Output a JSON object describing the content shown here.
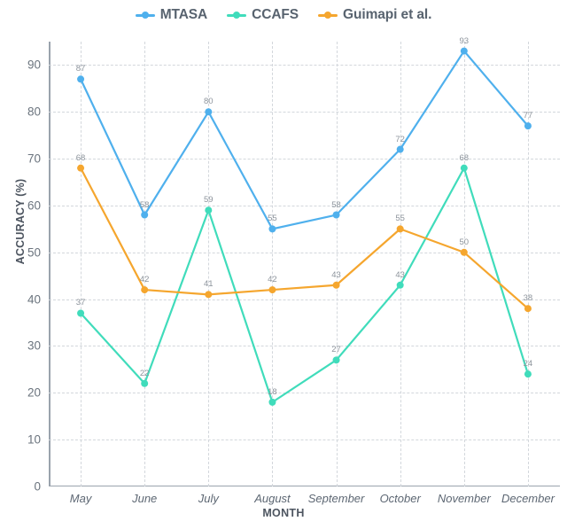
{
  "legend": {
    "position": "top-center",
    "items": [
      {
        "label": "MTASA",
        "color": "#4FB0ED",
        "marker": "line-dot-marker"
      },
      {
        "label": "CCAFS",
        "color": "#40DCBB",
        "marker": "line-dot-marker"
      },
      {
        "label": "Guimapi et al.",
        "color": "#F5A62E",
        "marker": "line-dot-marker"
      }
    ]
  },
  "axes": {
    "y_title": "ACCURACY (%)",
    "x_title": "MONTH",
    "y_ticks": [
      "0",
      "10",
      "20",
      "30",
      "40",
      "50",
      "60",
      "70",
      "80",
      "90"
    ]
  },
  "chart_data": {
    "type": "line",
    "title": "",
    "subtitle": "",
    "xlabel": "MONTH",
    "ylabel": "ACCURACY (%)",
    "categories": [
      "May",
      "June",
      "July",
      "August",
      "September",
      "October",
      "November",
      "December"
    ],
    "ylim": [
      0,
      95
    ],
    "yticks": [
      0,
      10,
      20,
      30,
      40,
      50,
      60,
      70,
      80,
      90
    ],
    "grid": true,
    "legend_position": "top-center",
    "data_labels": true,
    "series": [
      {
        "name": "MTASA",
        "color": "#4FB0ED",
        "values": [
          87,
          58,
          80,
          55,
          58,
          72,
          93,
          77
        ]
      },
      {
        "name": "CCAFS",
        "color": "#40DCBB",
        "values": [
          37,
          22,
          59,
          18,
          27,
          43,
          68,
          24
        ]
      },
      {
        "name": "Guimapi et al.",
        "color": "#F5A62E",
        "values": [
          68,
          42,
          41,
          42,
          43,
          55,
          50,
          38
        ]
      }
    ]
  }
}
